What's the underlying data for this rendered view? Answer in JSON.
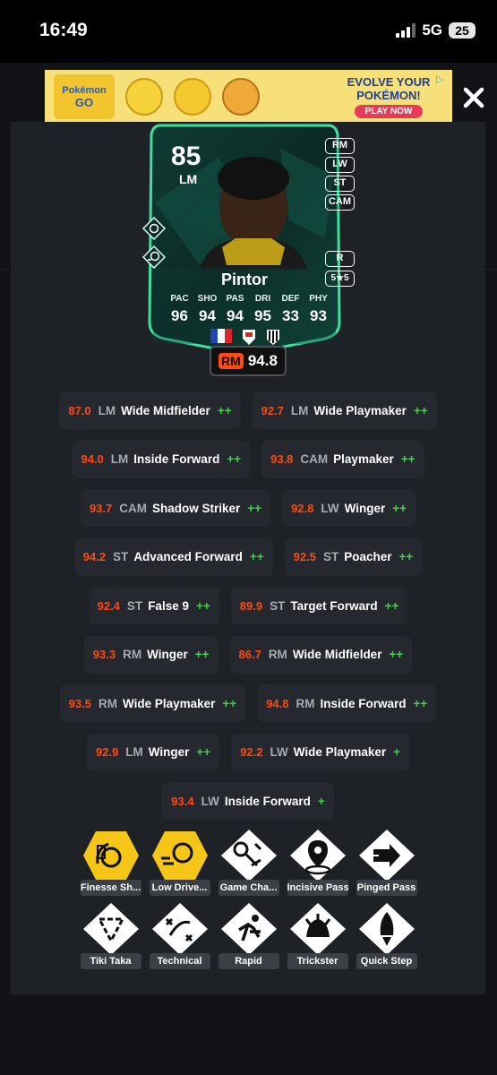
{
  "status_bar": {
    "time": "16:49",
    "network": "5G",
    "battery": "25"
  },
  "ad": {
    "logo_line1": "Pokémon",
    "logo_line2": "GO",
    "headline": "EVOLVE YOUR POKÉMON!",
    "cta": "PLAY NOW"
  },
  "card": {
    "rating": "85",
    "position": "LM",
    "alt_positions": [
      "RM",
      "LW",
      "ST",
      "CAM"
    ],
    "foot": "R",
    "skills_weakfoot": "5★5",
    "name": "Pintor",
    "stat_labels": [
      "PAC",
      "SHO",
      "PAS",
      "DRI",
      "DEF",
      "PHY"
    ],
    "stat_values": [
      "96",
      "94",
      "94",
      "95",
      "33",
      "93"
    ],
    "accent": "#3ee0a0"
  },
  "best_rating": {
    "position": "RM",
    "value": "94.8"
  },
  "roles": [
    [
      {
        "rating": "87.0",
        "pos": "LM",
        "name": "Wide Midfielder",
        "plus": "++"
      },
      {
        "rating": "92.7",
        "pos": "LM",
        "name": "Wide Playmaker",
        "plus": "++"
      }
    ],
    [
      {
        "rating": "94.0",
        "pos": "LM",
        "name": "Inside Forward",
        "plus": "++"
      },
      {
        "rating": "93.8",
        "pos": "CAM",
        "name": "Playmaker",
        "plus": "++"
      }
    ],
    [
      {
        "rating": "93.7",
        "pos": "CAM",
        "name": "Shadow Striker",
        "plus": "++"
      },
      {
        "rating": "92.8",
        "pos": "LW",
        "name": "Winger",
        "plus": "++"
      }
    ],
    [
      {
        "rating": "94.2",
        "pos": "ST",
        "name": "Advanced Forward",
        "plus": "++"
      },
      {
        "rating": "92.5",
        "pos": "ST",
        "name": "Poacher",
        "plus": "++"
      }
    ],
    [
      {
        "rating": "92.4",
        "pos": "ST",
        "name": "False 9",
        "plus": "++"
      },
      {
        "rating": "89.9",
        "pos": "ST",
        "name": "Target Forward",
        "plus": "++"
      }
    ],
    [
      {
        "rating": "93.3",
        "pos": "RM",
        "name": "Winger",
        "plus": "++"
      },
      {
        "rating": "86.7",
        "pos": "RM",
        "name": "Wide Midfielder",
        "plus": "++"
      }
    ],
    [
      {
        "rating": "93.5",
        "pos": "RM",
        "name": "Wide Playmaker",
        "plus": "++"
      },
      {
        "rating": "94.8",
        "pos": "RM",
        "name": "Inside Forward",
        "plus": "++"
      }
    ],
    [
      {
        "rating": "92.9",
        "pos": "LM",
        "name": "Winger",
        "plus": "++"
      },
      {
        "rating": "92.2",
        "pos": "LW",
        "name": "Wide Playmaker",
        "plus": "+"
      }
    ],
    [
      {
        "rating": "93.4",
        "pos": "LW",
        "name": "Inside Forward",
        "plus": "+"
      }
    ]
  ],
  "playstyles_row1": [
    {
      "label": "Finesse Sh...",
      "icon": "finesse-shot-icon",
      "plus": true
    },
    {
      "label": "Low Drive...",
      "icon": "low-driven-shot-icon",
      "plus": true
    },
    {
      "label": "Game Cha...",
      "icon": "game-changer-icon",
      "plus": false
    },
    {
      "label": "Incisive Pass",
      "icon": "incisive-pass-icon",
      "plus": false
    },
    {
      "label": "Pinged Pass",
      "icon": "pinged-pass-icon",
      "plus": false
    }
  ],
  "playstyles_row2": [
    {
      "label": "Tiki Taka",
      "icon": "tiki-taka-icon",
      "plus": false
    },
    {
      "label": "Technical",
      "icon": "technical-icon",
      "plus": false
    },
    {
      "label": "Rapid",
      "icon": "rapid-icon",
      "plus": false
    },
    {
      "label": "Trickster",
      "icon": "trickster-icon",
      "plus": false
    },
    {
      "label": "Quick Step",
      "icon": "quick-step-icon",
      "plus": false
    }
  ],
  "colors": {
    "playstyle_plus": "#f5c518",
    "playstyle_base": "#ffffff",
    "rating_orange": "#ff4a12",
    "plus_green": "#3fd14a"
  }
}
